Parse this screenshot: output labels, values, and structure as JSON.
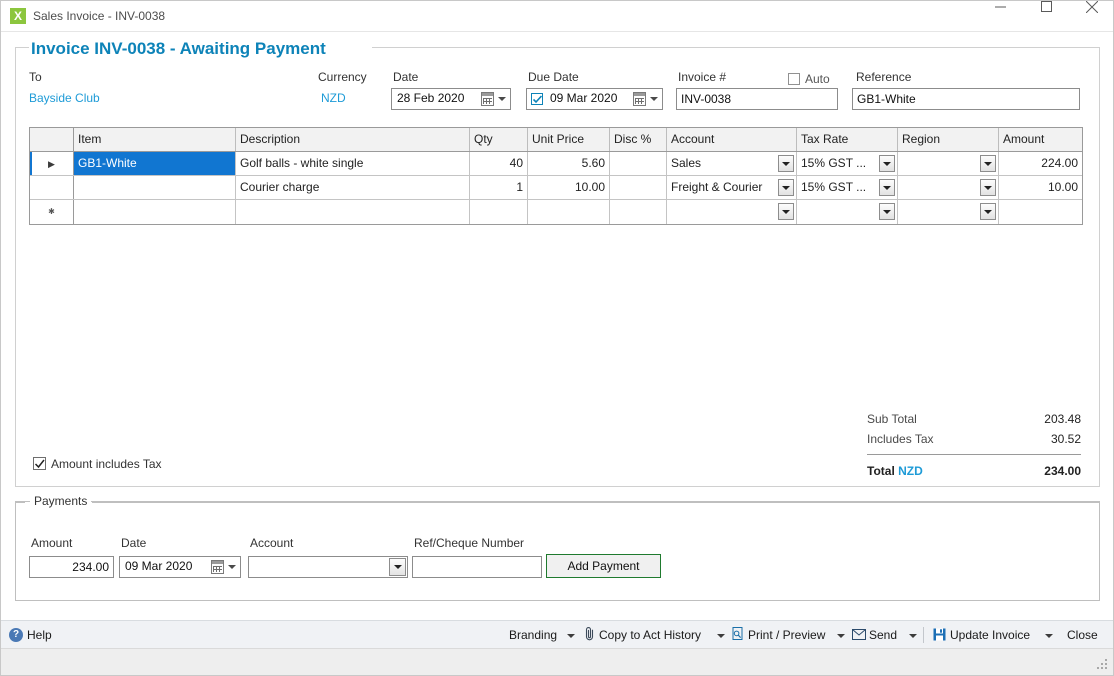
{
  "window": {
    "title": "Sales Invoice - INV-0038",
    "app_icon": "xero-x-icon",
    "minimize": "minimize-icon",
    "maximize": "maximize-icon",
    "close": "close-icon"
  },
  "invoice": {
    "heading": "Invoice INV-0038 - Awaiting Payment",
    "to_label": "To",
    "to_value": "Bayside Club",
    "currency_label": "Currency",
    "currency_value": "NZD",
    "date_label": "Date",
    "date_value": "28 Feb 2020",
    "due_date_label": "Due Date",
    "due_date_value": "09 Mar 2020",
    "due_date_checked": true,
    "invoice_no_label": "Invoice #",
    "invoice_no_value": "INV-0038",
    "auto_label": "Auto",
    "auto_checked": false,
    "reference_label": "Reference",
    "reference_value": "GB1-White"
  },
  "grid": {
    "columns": [
      "",
      "Item",
      "Description",
      "Qty",
      "Unit Price",
      "Disc %",
      "Account",
      "Tax Rate",
      "Region",
      "Amount"
    ],
    "rows": [
      {
        "marker": "▶",
        "item": "GB1-White",
        "item_selected": true,
        "description": "Golf balls - white single",
        "qty": "40",
        "unit_price": "5.60",
        "disc": "",
        "account": "Sales",
        "tax_rate": "15% GST ...",
        "region": "",
        "amount": "224.00"
      },
      {
        "marker": "",
        "item": "",
        "item_selected": false,
        "description": "Courier charge",
        "qty": "1",
        "unit_price": "10.00",
        "disc": "",
        "account": "Freight & Courier",
        "tax_rate": "15% GST ...",
        "region": "",
        "amount": "10.00"
      },
      {
        "marker": "✱",
        "item": "",
        "item_selected": false,
        "description": "",
        "qty": "",
        "unit_price": "",
        "disc": "",
        "account": "",
        "tax_rate": "",
        "region": "",
        "amount": ""
      }
    ]
  },
  "totals": {
    "sub_total_label": "Sub Total",
    "sub_total_value": "203.48",
    "includes_tax_label": "Includes Tax",
    "includes_tax_value": "30.52",
    "total_label": "Total",
    "total_currency": "NZD",
    "total_value": "234.00"
  },
  "amount_includes_tax": {
    "label": "Amount includes Tax",
    "checked": true
  },
  "payments": {
    "group_label": "Payments",
    "amount_label": "Amount",
    "amount_value": "234.00",
    "date_label": "Date",
    "date_value": "09 Mar 2020",
    "account_label": "Account",
    "account_value": "",
    "ref_label": "Ref/Cheque Number",
    "ref_value": "",
    "add_payment_label": "Add Payment"
  },
  "toolbar": {
    "help_label": "Help",
    "help_icon": "question-mark-icon",
    "branding_label": "Branding",
    "copy_label": "Copy to Act History",
    "copy_icon": "paperclip-icon",
    "print_label": "Print / Preview",
    "print_icon": "print-preview-icon",
    "send_label": "Send",
    "send_icon": "envelope-icon",
    "update_label": "Update Invoice",
    "update_icon": "save-disk-icon",
    "close_label": "Close"
  },
  "colors": {
    "accent": "#0d83b8",
    "link": "#1e9bd7",
    "selection": "#1176d1",
    "app_icon_bg": "#8cc63e",
    "green_button_border": "#1f7a2e"
  }
}
